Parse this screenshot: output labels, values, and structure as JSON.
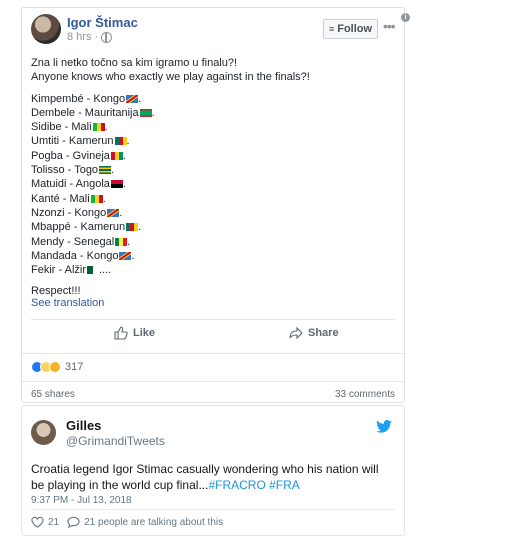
{
  "facebook_post": {
    "author": "Igor Štimac",
    "time": "8 hrs",
    "follow_label": "Follow",
    "more_label": "•••",
    "info_label": "i",
    "text_line1": "Zna li netko točno sa kim igramo u finalu?!",
    "text_line2": "Anyone knows who exactly we play against in the finals?!",
    "lines": [
      {
        "text": "Kimpembé - Kongo",
        "flag": "congo",
        "suffix": "."
      },
      {
        "text": "Dembele - Mauritanija",
        "flag": "mauritania",
        "suffix": "."
      },
      {
        "text": "Sidibe - Mali",
        "flag": "mali",
        "suffix": "."
      },
      {
        "text": "Umtiti - Kamerun",
        "flag": "cameroon",
        "suffix": "."
      },
      {
        "text": "Pogba - Gvineja",
        "flag": "guinea",
        "suffix": "."
      },
      {
        "text": "Tolisso - Togo",
        "flag": "togo",
        "suffix": "."
      },
      {
        "text": "Matuidi - Angola",
        "flag": "angola",
        "suffix": "."
      },
      {
        "text": "Kanté - Mali",
        "flag": "mali",
        "suffix": "."
      },
      {
        "text": "Nzonzi - Kongo",
        "flag": "congo",
        "suffix": "."
      },
      {
        "text": "Mbappé - Kamerun",
        "flag": "cameroon",
        "suffix": "."
      },
      {
        "text": "Mendy - Senegal",
        "flag": "senegal",
        "suffix": "."
      },
      {
        "text": "Mandada - Kongo",
        "flag": "congo",
        "suffix": "."
      },
      {
        "text": "Fekir - Alžir",
        "flag": "algeria",
        "suffix": "...."
      }
    ],
    "closing": "Respect!!!",
    "see_translation": "See translation",
    "like_label": "Like",
    "share_label": "Share",
    "reactions_count": "317",
    "shares": "65 shares",
    "comments": "33 comments"
  },
  "tweet": {
    "name": "Gilles",
    "handle": "@GrimandiTweets",
    "text": "Croatia legend Igor Stimac casually wondering who his nation will be playing in the world cup final...",
    "hashtags": "#FRACRO #FRA",
    "date": "9:37 PM - Jul 13, 2018",
    "likes": "21",
    "talking": "21 people are talking about this"
  },
  "colors": {
    "fb_link": "#365899",
    "twitter_blue": "#1da1f2",
    "hashtag": "#1b95e0"
  },
  "icons": [
    "globe-icon",
    "rss-icon",
    "more-icon",
    "info-icon",
    "thumbs-up-icon",
    "share-arrow-icon",
    "like-reaction-icon",
    "haha-reaction-icon",
    "wow-reaction-icon",
    "twitter-bird-icon",
    "heart-icon",
    "comment-bubble-icon"
  ]
}
